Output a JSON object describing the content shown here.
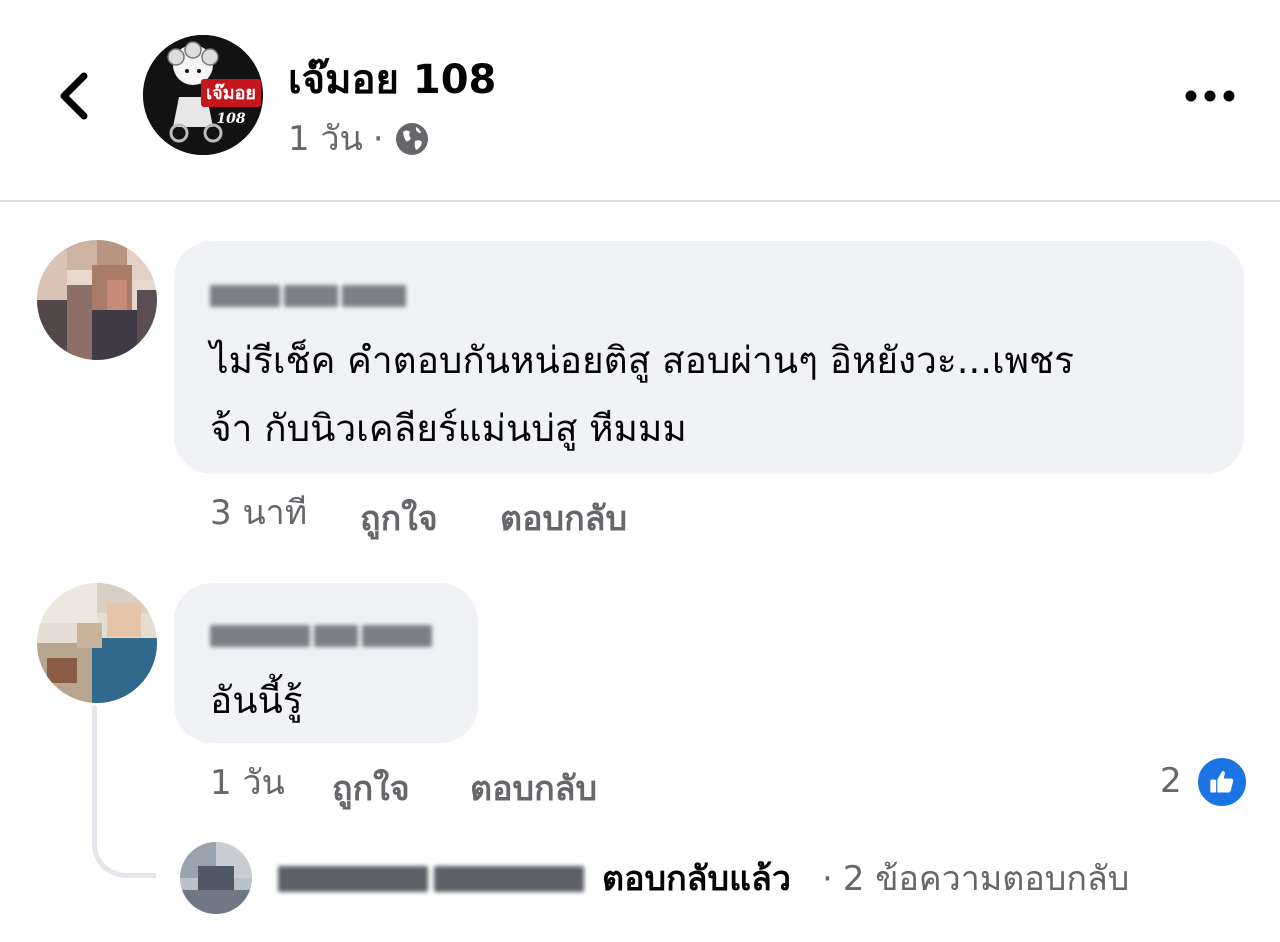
{
  "header": {
    "page_name": "เจ๊มอย 108",
    "avatar_logo_text": "เจ๊มอย",
    "avatar_logo_number": "108",
    "post_time": "1 วัน",
    "separator": "·",
    "privacy_icon": "globe-icon",
    "back_icon": "chevron-left-icon",
    "more_icon": "more-horizontal-icon"
  },
  "comments": [
    {
      "text_line1": "ไม่รีเช็ค คำตอบกันหน่อยติสู สอบผ่านๆ อิหยังวะ...เพชร",
      "text_line2": "จ้า กับนิวเคลียร์แม่นบ่สู หีมมม",
      "time": "3 นาที",
      "like_label": "ถูกใจ",
      "reply_label": "ตอบกลับ"
    },
    {
      "text": "อันนี้รู้",
      "time": "1 วัน",
      "like_label": "ถูกใจ",
      "reply_label": "ตอบกลับ",
      "reaction_count": "2",
      "reaction_icon": "like-thumb-icon",
      "replies": {
        "action_text": "ตอบกลับแล้ว",
        "separator": "·",
        "count_text": "2 ข้อความตอบกลับ"
      }
    }
  ],
  "colors": {
    "bubble": "#f0f2f5",
    "secondary_text": "#65676b",
    "like_blue": "#1b74e4",
    "divider": "#dcdcdc"
  }
}
